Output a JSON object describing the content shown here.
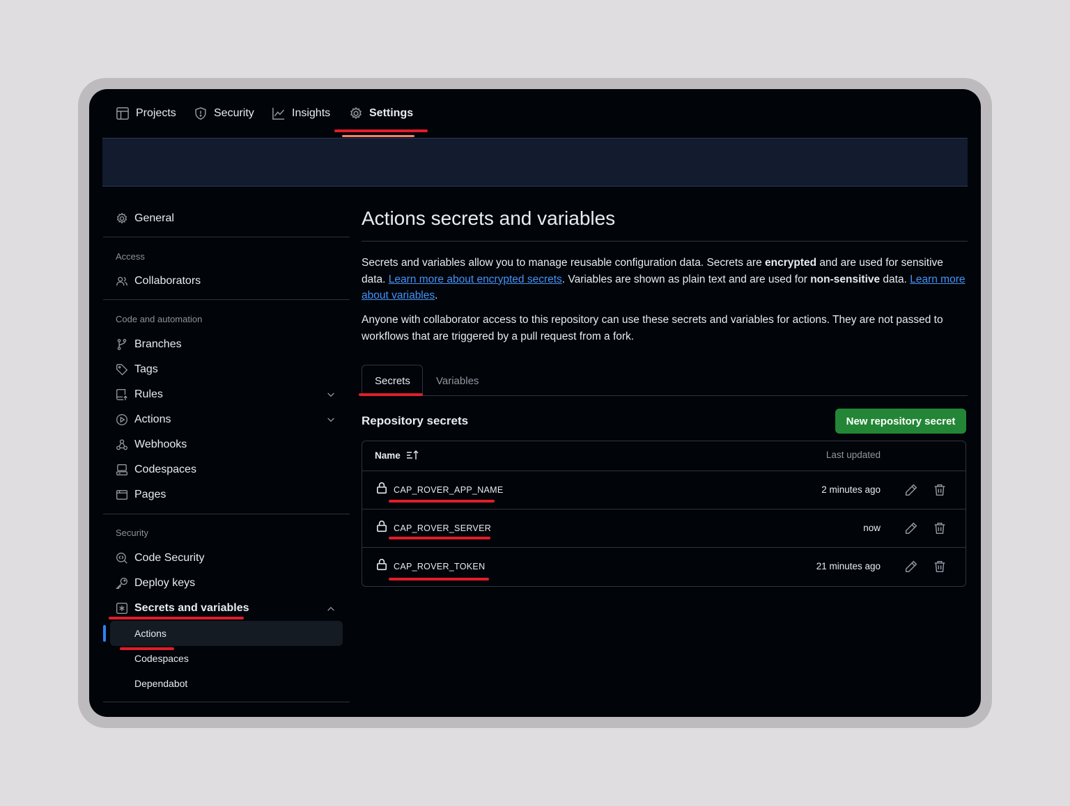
{
  "top_tabs": [
    {
      "label": "Projects",
      "icon": "table-icon"
    },
    {
      "label": "Security",
      "icon": "shield-icon"
    },
    {
      "label": "Insights",
      "icon": "graph-icon"
    },
    {
      "label": "Settings",
      "icon": "gear-icon",
      "active": true
    }
  ],
  "sidebar": {
    "general": "General",
    "access_heading": "Access",
    "collaborators": "Collaborators",
    "code_heading": "Code and automation",
    "branches": "Branches",
    "tags": "Tags",
    "rules": "Rules",
    "actions": "Actions",
    "webhooks": "Webhooks",
    "codespaces": "Codespaces",
    "pages": "Pages",
    "security_heading": "Security",
    "code_security": "Code Security",
    "deploy_keys": "Deploy keys",
    "secrets_vars": "Secrets and variables",
    "sub_actions": "Actions",
    "sub_codespaces": "Codespaces",
    "sub_dependabot": "Dependabot"
  },
  "main": {
    "title": "Actions secrets and variables",
    "p1_a": "Secrets and variables allow you to manage reusable configuration data. Secrets are ",
    "p1_b": "encrypted",
    "p1_c": " and are used for sensitive data. ",
    "p1_link1": "Learn more about encrypted secrets",
    "p1_d": ". Variables are shown as plain text and are used for ",
    "p1_e": "non-sensitive",
    "p1_f": " data. ",
    "p1_link2": "Learn more about variables",
    "p1_g": ".",
    "p2": "Anyone with collaborator access to this repository can use these secrets and variables for actions. They are not passed to workflows that are triggered by a pull request from a fork.",
    "tab_secrets": "Secrets",
    "tab_variables": "Variables",
    "repo_secrets": "Repository secrets",
    "new_secret_btn": "New repository secret",
    "col_name": "Name",
    "col_updated": "Last updated",
    "secrets": [
      {
        "name": "CAP_ROVER_APP_NAME",
        "updated": "2 minutes ago"
      },
      {
        "name": "CAP_ROVER_SERVER",
        "updated": "now"
      },
      {
        "name": "CAP_ROVER_TOKEN",
        "updated": "21 minutes ago"
      }
    ]
  },
  "colors": {
    "accent_red": "#e11d2a",
    "button_green": "#238636",
    "link_blue": "#4493f8",
    "active_marker": "#2f81f7"
  }
}
